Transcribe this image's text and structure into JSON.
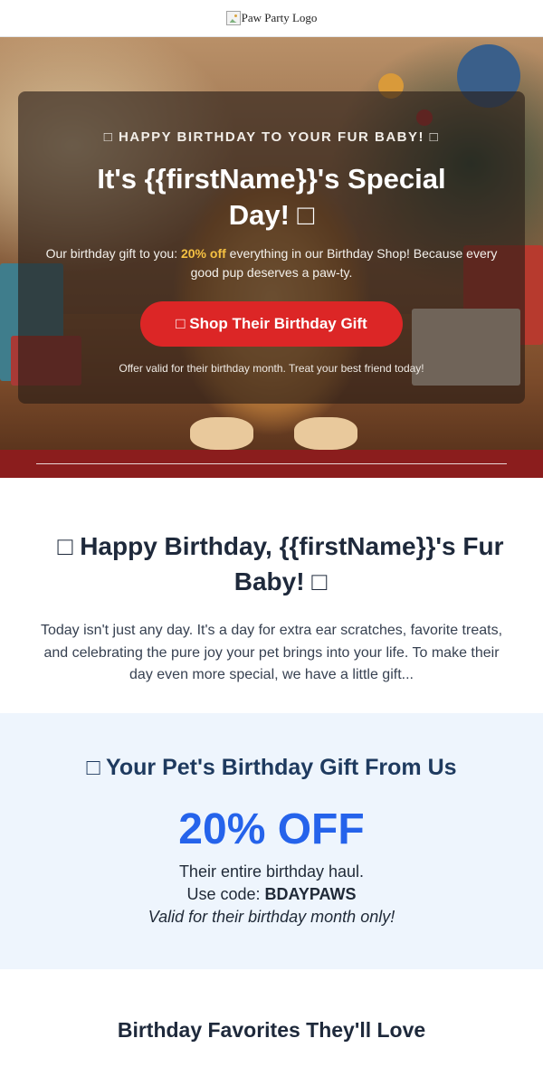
{
  "header": {
    "logo_alt": "Paw Party Logo"
  },
  "hero": {
    "kicker": "□ HAPPY BIRTHDAY TO YOUR FUR BABY! □",
    "title": "It's {{firstName}}'s Special Day! □",
    "text_prefix": "Our birthday gift to you: ",
    "text_highlight": "20% off",
    "text_suffix": " everything in our Birthday Shop! Because every good pup deserves a paw-ty.",
    "cta_label": "□ Shop Their Birthday Gift",
    "fineprint": "Offer valid for their birthday month. Treat your best friend today!"
  },
  "intro": {
    "heading": "□ Happy Birthday, {{firstName}}'s Fur Baby! □",
    "body": "Today isn't just any day. It's a day for extra ear scratches, favorite treats, and celebrating the pure joy your pet brings into your life. To make their day even more special, we have a little gift..."
  },
  "gift": {
    "heading": "□ Your Pet's Birthday Gift From Us",
    "discount": "20% OFF",
    "line1": "Their entire birthday haul.",
    "line2_prefix": "Use code: ",
    "code": "BDAYPAWS",
    "note": "Valid for their birthday month only!"
  },
  "favorites": {
    "heading": "Birthday Favorites They'll Love"
  },
  "colors": {
    "cta": "#dc2626",
    "band": "#8b1d1d",
    "discount": "#2563eb",
    "highlight": "#f6c142",
    "gift_bg": "#eef5fd"
  }
}
